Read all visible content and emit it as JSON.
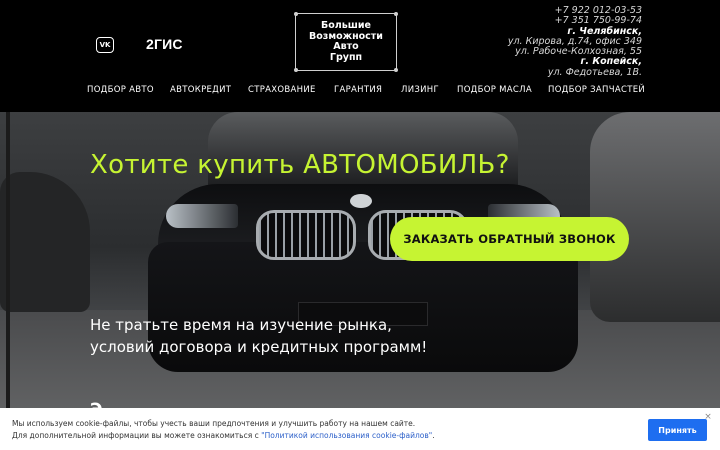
{
  "header": {
    "vk_icon_text": "VK",
    "gis_label": "2ГИС",
    "logo_lines": [
      "Большие",
      "Возможности",
      "Авто",
      "Групп"
    ],
    "contacts": {
      "phone1": "+7 922 012-03-53",
      "phone2": "+7 351 750-99-74",
      "city1": "г. Челябинск,",
      "address1": "ул. Кирова, д.74, офис 349",
      "address2": "ул. Рабоче-Колхозная, 55",
      "city2": "г. Копейск,",
      "address3": "ул. Федотьева, 1В."
    }
  },
  "nav": {
    "items": [
      "ПОДБОР АВТО",
      "АВТОКРЕДИТ",
      "СТРАХОВАНИЕ",
      "ГАРАНТИЯ",
      "ЛИЗИНГ",
      "ПОДБОР МАСЛА",
      "ПОДБОР ЗАПЧАСТЕЙ"
    ]
  },
  "hero": {
    "title": "Хотите купить АВТОМОБИЛЬ?",
    "cta_label": "ЗАКАЗАТЬ ОБРАТНЫЙ ЗВОНОК",
    "text_line1": "Не тратьте время на изучение рынка,",
    "text_line2": "условий договора и кредитных программ!",
    "text_partial": "Э…"
  },
  "cookie": {
    "line1": "Мы используем cookie-файлы, чтобы учесть ваши предпочтения и улучшить работу на нашем сайте.",
    "line2_prefix": "Для дополнительной информации вы можете ознакомиться с ",
    "link_text": "\"Политикой использования cookie-файлов\"",
    "line2_suffix": ".",
    "accept_label": "Принять",
    "close_symbol": "×"
  },
  "colors": {
    "accent": "#c6f432",
    "button_blue": "#1e6ef0",
    "background": "#000000"
  }
}
